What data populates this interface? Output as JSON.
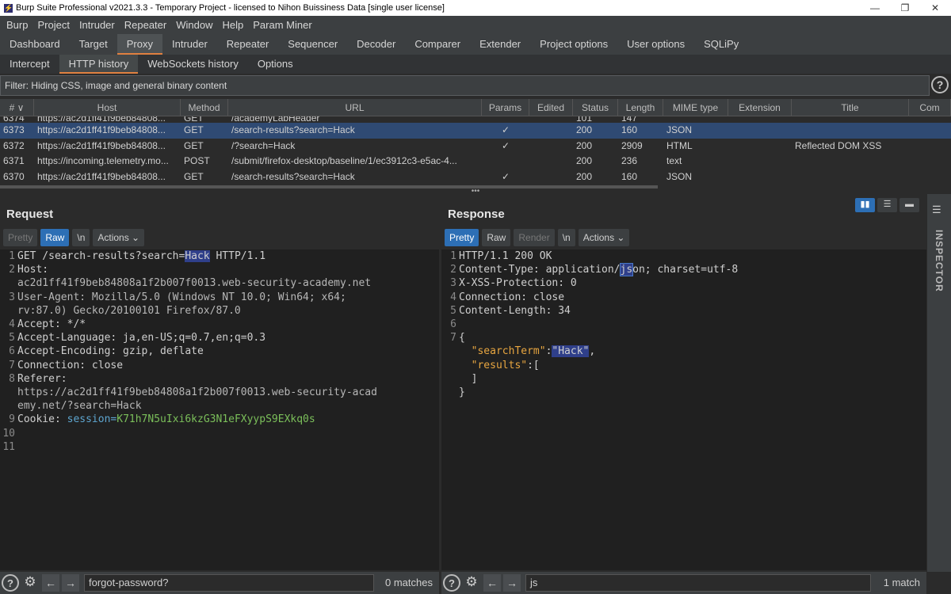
{
  "window": {
    "title": "Burp Suite Professional v2021.3.3 - Temporary Project - licensed to Nihon Buissiness Data [single user license]",
    "minimize": "—",
    "restore": "❐",
    "close": "✕"
  },
  "menu": [
    "Burp",
    "Project",
    "Intruder",
    "Repeater",
    "Window",
    "Help",
    "Param Miner"
  ],
  "main_tabs": [
    "Dashboard",
    "Target",
    "Proxy",
    "Intruder",
    "Repeater",
    "Sequencer",
    "Decoder",
    "Comparer",
    "Extender",
    "Project options",
    "User options",
    "SQLiPy"
  ],
  "proxy_tabs": [
    "Intercept",
    "HTTP history",
    "WebSockets history",
    "Options"
  ],
  "filter": "Filter: Hiding CSS, image and general binary content",
  "table": {
    "columns": [
      "# ∨",
      "Host",
      "Method",
      "URL",
      "Params",
      "Edited",
      "Status",
      "Length",
      "MIME type",
      "Extension",
      "Title",
      "Com"
    ],
    "partial_row": {
      "num": "6374",
      "host": "https://ac2d1ff41f9beb84808...",
      "method": "GET",
      "url": "/academyLabHeader",
      "status": "101",
      "length": "147"
    },
    "rows": [
      {
        "num": "6373",
        "host": "https://ac2d1ff41f9beb84808...",
        "method": "GET",
        "url": "/search-results?search=Hack",
        "params": "✓",
        "edited": "",
        "status": "200",
        "length": "160",
        "mime": "JSON",
        "ext": "",
        "title": ""
      },
      {
        "num": "6372",
        "host": "https://ac2d1ff41f9beb84808...",
        "method": "GET",
        "url": "/?search=Hack",
        "params": "✓",
        "edited": "",
        "status": "200",
        "length": "2909",
        "mime": "HTML",
        "ext": "",
        "title": "Reflected DOM XSS"
      },
      {
        "num": "6371",
        "host": "https://incoming.telemetry.mo...",
        "method": "POST",
        "url": "/submit/firefox-desktop/baseline/1/ec3912c3-e5ac-4...",
        "params": "",
        "edited": "",
        "status": "200",
        "length": "236",
        "mime": "text",
        "ext": "",
        "title": ""
      },
      {
        "num": "6370",
        "host": "https://ac2d1ff41f9beb84808...",
        "method": "GET",
        "url": "/search-results?search=Hack",
        "params": "✓",
        "edited": "",
        "status": "200",
        "length": "160",
        "mime": "JSON",
        "ext": "",
        "title": ""
      }
    ]
  },
  "splitter": "•••",
  "request": {
    "title": "Request",
    "buttons": {
      "pretty": "Pretty",
      "raw": "Raw",
      "newline": "\\n",
      "actions": "Actions ⌄"
    },
    "lines": {
      "l1a": "GET /search-results?search=",
      "l1hl": "Hack",
      "l1b": " HTTP/1.1",
      "l2": "Host:",
      "l2c": "ac2d1ff41f9beb84808a1f2b007f0013.web-security-academy.net",
      "l3": "User-Agent: Mozilla/5.0 (Windows NT 10.0; Win64; x64;",
      "l3c": "rv:87.0) Gecko/20100101 Firefox/87.0",
      "l4": "Accept: */*",
      "l5": "Accept-Language: ja,en-US;q=0.7,en;q=0.3",
      "l6": "Accept-Encoding: gzip, deflate",
      "l7": "Connection: close",
      "l8": "Referer:",
      "l8c": "https://ac2d1ff41f9beb84808a1f2b007f0013.web-security-acad",
      "l8d": "emy.net/?search=Hack",
      "l9a": "Cookie: ",
      "l9name": "session",
      "l9eq": "=",
      "l9val": "K71h7N5uIxi6kzG3N1eFXyypS9EXkq0s"
    },
    "search": {
      "value": "forgot-password?",
      "matches": "0 matches"
    }
  },
  "response": {
    "title": "Response",
    "buttons": {
      "pretty": "Pretty",
      "raw": "Raw",
      "render": "Render",
      "newline": "\\n",
      "actions": "Actions ⌄"
    },
    "lines": {
      "l1": "HTTP/1.1 200 OK",
      "l2a": "Content-Type: application/",
      "l2hl": "js",
      "l2b": "on; charset=utf-8",
      "l3": "X-XSS-Protection: 0",
      "l4": "Connection: close",
      "l5": "Content-Length: 34",
      "l7": "{",
      "k1": "\"searchTerm\"",
      "colon1": ":",
      "v1": "\"Hack\"",
      "comma1": ",",
      "k2": "\"results\"",
      "colon2": ":[",
      "close1": "]",
      "close2": "}"
    },
    "search": {
      "value": "js",
      "matches": "1 match"
    }
  },
  "view_buttons": [
    "▮▮",
    "☰",
    "▬"
  ],
  "inspector": {
    "label": "INSPECTOR",
    "menu_icon": "☰"
  },
  "icons": {
    "help": "?",
    "gear": "⚙",
    "back": "←",
    "forward": "→"
  },
  "accent_color": "#e08040",
  "selection_color": "#2d6fb5"
}
